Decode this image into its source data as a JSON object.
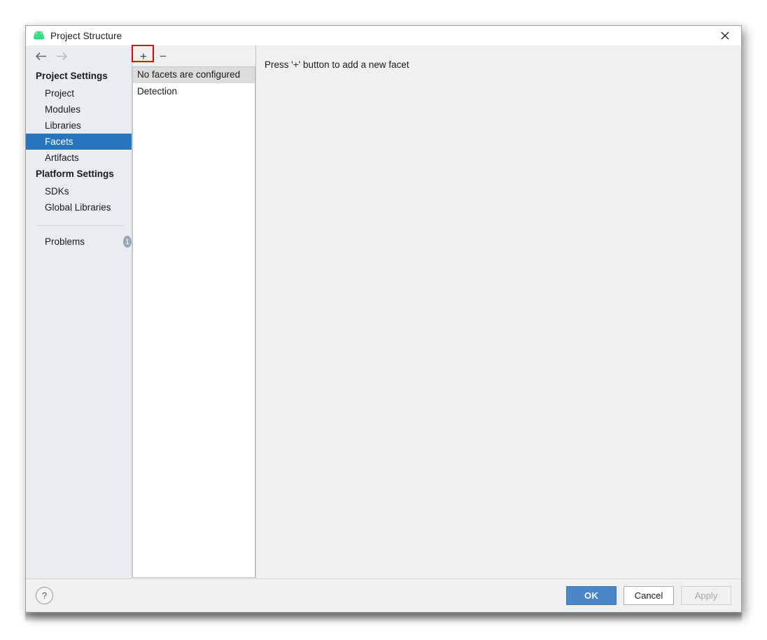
{
  "window": {
    "title": "Project Structure",
    "app_icon": "android-robot-icon",
    "close_icon": "close-icon"
  },
  "nav": {
    "back_icon": "arrow-left-icon",
    "forward_icon": "arrow-right-icon"
  },
  "sidebar": {
    "groups": [
      {
        "header": "Project Settings",
        "items": [
          {
            "label": "Project",
            "selected": false
          },
          {
            "label": "Modules",
            "selected": false
          },
          {
            "label": "Libraries",
            "selected": false
          },
          {
            "label": "Facets",
            "selected": true
          },
          {
            "label": "Artifacts",
            "selected": false
          }
        ]
      },
      {
        "header": "Platform Settings",
        "items": [
          {
            "label": "SDKs",
            "selected": false
          },
          {
            "label": "Global Libraries",
            "selected": false
          }
        ]
      }
    ],
    "problems": {
      "label": "Problems",
      "count": "1"
    }
  },
  "facet_pane": {
    "toolbar": {
      "add_label": "+",
      "remove_label": "−",
      "add_highlighted": true,
      "highlight_color": "#e60000"
    },
    "list_header": "No facets are configured",
    "rows": [
      {
        "label": "Detection"
      }
    ]
  },
  "detail_pane": {
    "hint": "Press '+' button to add a new facet"
  },
  "footer": {
    "help_label": "?",
    "buttons": [
      {
        "label": "OK",
        "style": "primary"
      },
      {
        "label": "Cancel",
        "style": "normal"
      },
      {
        "label": "Apply",
        "style": "disabled"
      }
    ]
  },
  "colors": {
    "selection_blue": "#2675bf",
    "primary_button": "#4a87c8",
    "sidebar_bg": "#e7edf1",
    "panel_bg": "#f0f0f0",
    "badge_gray": "#9aa7b4"
  }
}
